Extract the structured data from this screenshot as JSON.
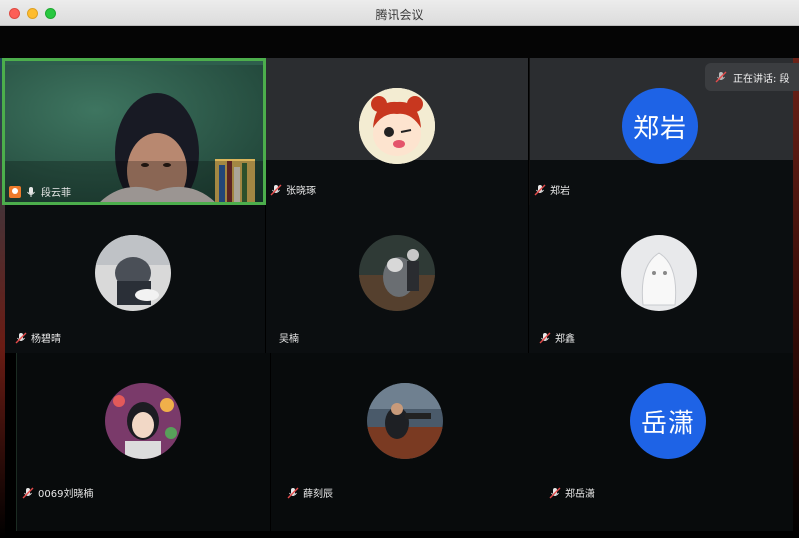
{
  "window": {
    "title": "腾讯会议"
  },
  "speaking": {
    "label": "正在讲话: 段"
  },
  "participants": [
    {
      "name": "段云菲",
      "kind": "video",
      "host": true,
      "active": true
    },
    {
      "name": "张晓琢",
      "kind": "cartoon-avatar"
    },
    {
      "name": "郑岩",
      "kind": "name-avatar",
      "avatar_text": "郑岩"
    },
    {
      "name": "杨碧晴",
      "kind": "photo-avatar"
    },
    {
      "name": "吴楠",
      "kind": "photo-avatar"
    },
    {
      "name": "郑鑫",
      "kind": "photo-avatar"
    },
    {
      "name": "0069刘晓楠",
      "kind": "photo-avatar"
    },
    {
      "name": "薛刻辰",
      "kind": "photo-avatar"
    },
    {
      "name": "郑岳潇",
      "kind": "name-avatar",
      "avatar_text": "岳潇"
    }
  ],
  "colors": {
    "active_border": "#4cae4c",
    "name_avatar_bg": "#1e63e6",
    "tile_gray": "#2b2d30",
    "host_badge": "#ef7a2a"
  }
}
